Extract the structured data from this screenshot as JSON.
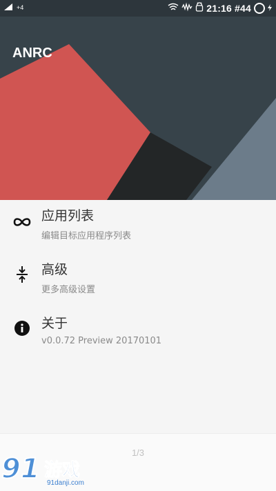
{
  "status_bar": {
    "left_indicator": "+4",
    "time": "21:16",
    "extra": "#44"
  },
  "app": {
    "title": "ANRC",
    "colors": {
      "header_dark": "#37434a",
      "header_red": "#d05552",
      "header_black": "#232627",
      "header_slate": "#6c7c8a"
    }
  },
  "menu": {
    "items": [
      {
        "icon": "infinity-icon",
        "title": "应用列表",
        "subtitle": "编辑目标应用程序列表"
      },
      {
        "icon": "collapse-icon",
        "title": "高级",
        "subtitle": "更多高级设置"
      },
      {
        "icon": "info-icon",
        "title": "关于",
        "subtitle": "v0.0.72 Preview 20170101"
      }
    ]
  },
  "footer": {
    "page_indicator": "1/3"
  },
  "watermark": {
    "number": "91",
    "text": "游戏",
    "url": "91danji.com"
  }
}
